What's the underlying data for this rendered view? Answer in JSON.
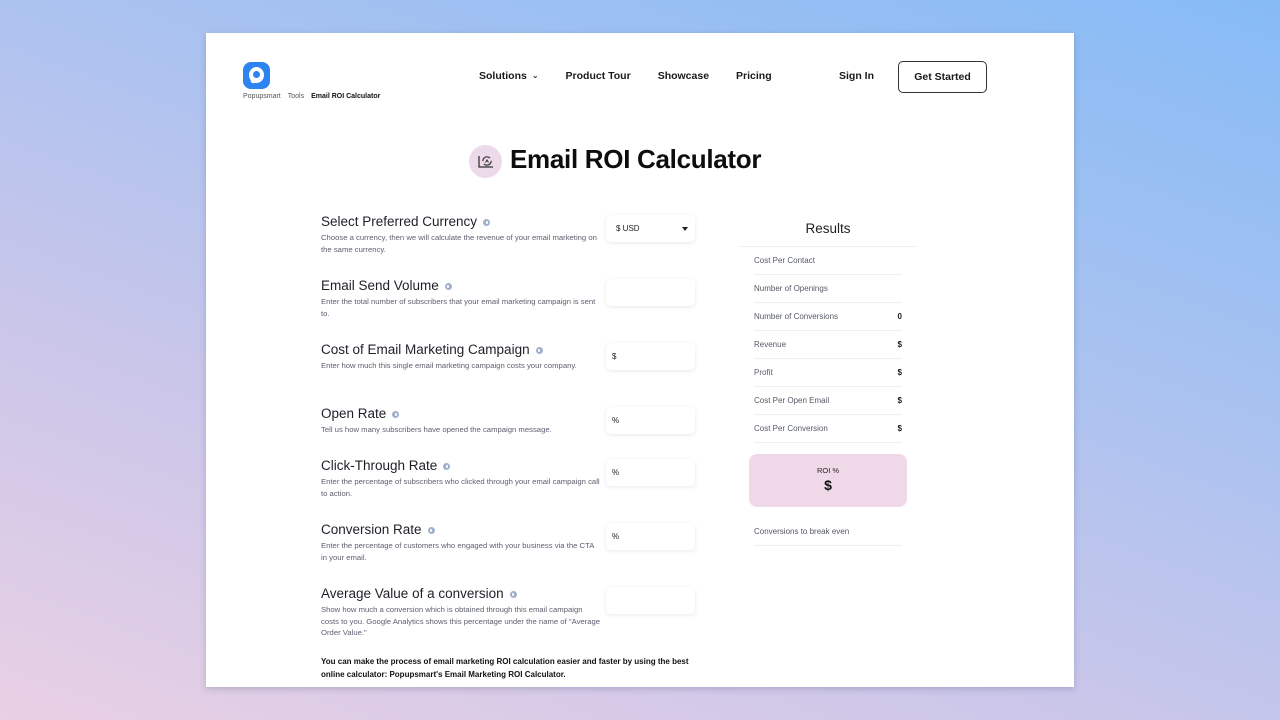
{
  "brand": {
    "name": "Popupsmart",
    "color": "#2d83f0"
  },
  "breadcrumb": [
    "Popupsmart",
    "Tools",
    "Email ROI Calculator"
  ],
  "nav": {
    "items": [
      {
        "label": "Solutions",
        "has_dropdown": true
      },
      {
        "label": "Product Tour"
      },
      {
        "label": "Showcase"
      },
      {
        "label": "Pricing"
      }
    ],
    "sign_in": "Sign In",
    "get_started": "Get Started"
  },
  "page": {
    "title": "Email ROI Calculator",
    "title_icon": "refresh-chart-icon"
  },
  "form": {
    "fields": [
      {
        "label": "Select Preferred Currency",
        "description": "Choose a currency, then we will calculate the revenue of your email marketing on the same currency.",
        "input_type": "select",
        "value": "$ USD"
      },
      {
        "label": "Email Send Volume",
        "description": "Enter the total number of subscribers that your email marketing campaign is sent to.",
        "input_type": "number",
        "prefix": ""
      },
      {
        "label": "Cost of Email Marketing Campaign",
        "description": "Enter how much this single email marketing campaign costs your company.",
        "input_type": "number",
        "prefix": "$"
      },
      {
        "label": "Open Rate",
        "description": "Tell us how many subscribers have opened the campaign message.",
        "input_type": "number",
        "prefix": "%"
      },
      {
        "label": "Click-Through Rate",
        "description": "Enter the percentage of subscribers who clicked through your email campaign call to action.",
        "input_type": "number",
        "prefix": "%"
      },
      {
        "label": "Conversion Rate",
        "description": "Enter the percentage of customers who engaged with your business via the CTA in your email.",
        "input_type": "number",
        "prefix": "%"
      },
      {
        "label": "Average Value of a conversion",
        "description": "Show how much a conversion which is obtained through this email campaign costs to you. Google Analytics shows this percentage under the name of \"Average Order Value.\"",
        "input_type": "number",
        "prefix": ""
      }
    ],
    "note": "You can make the process of email marketing ROI calculation easier and faster by using the best online calculator: Popupsmart's Email Marketing ROI Calculator."
  },
  "results": {
    "title": "Results",
    "rows": [
      {
        "label": "Cost Per Contact",
        "value": ""
      },
      {
        "label": "Number of Openings",
        "value": ""
      },
      {
        "label": "Number of Conversions",
        "value": "0"
      },
      {
        "label": "Revenue",
        "value": "$"
      },
      {
        "label": "Profit",
        "value": "$"
      },
      {
        "label": "Cost Per Open Email",
        "value": "$"
      },
      {
        "label": "Cost Per Conversion",
        "value": "$"
      }
    ],
    "roi": {
      "label": "ROI %",
      "value": "$",
      "color": "#efd8e8"
    },
    "break_even": {
      "label": "Conversions to break even",
      "value": ""
    }
  }
}
